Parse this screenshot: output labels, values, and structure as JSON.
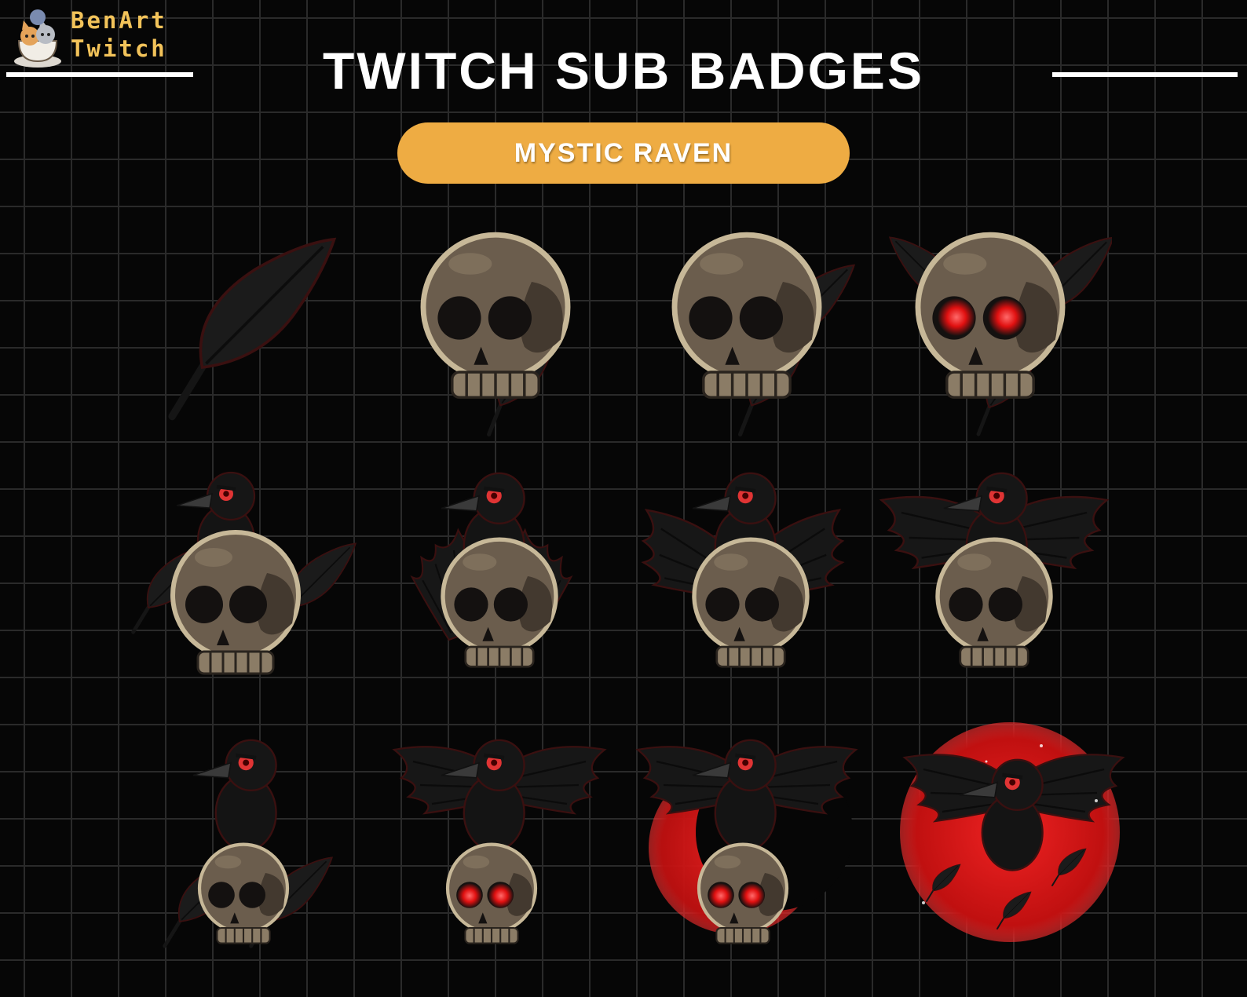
{
  "brand": {
    "line1": "BenArt",
    "line2": "Twitch"
  },
  "title": "TWITCH SUB BADGES",
  "subtitle": "MYSTIC RAVEN",
  "colors": {
    "background": "#060606",
    "grid": "#2a2a2a",
    "accent": "#eeac43",
    "skull": "#6b5d4d",
    "glow": "#e01818"
  },
  "badges": [
    {
      "name": "feather-icon"
    },
    {
      "name": "skull-feather-icon"
    },
    {
      "name": "skull-feathers-icon"
    },
    {
      "name": "skull-red-eyes-icon"
    },
    {
      "name": "raven-skull-icon"
    },
    {
      "name": "raven-skull-wings-icon"
    },
    {
      "name": "raven-skull-spread-icon"
    },
    {
      "name": "raven-skull-wide-icon"
    },
    {
      "name": "raven-on-skull-icon"
    },
    {
      "name": "raven-on-red-eye-skull-icon"
    },
    {
      "name": "raven-red-moon-skull-icon"
    },
    {
      "name": "raven-red-moon-icon"
    }
  ]
}
